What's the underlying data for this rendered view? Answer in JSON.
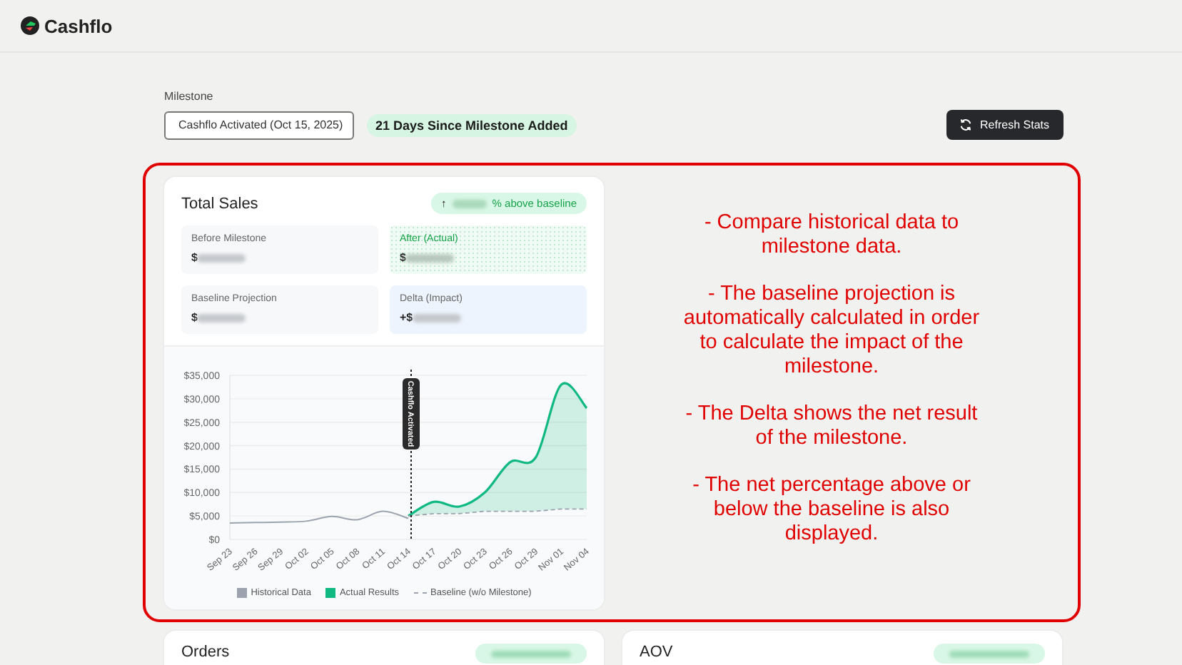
{
  "brand": {
    "name": "Cashflo"
  },
  "milestone": {
    "label": "Milestone",
    "selected_option": "Cashflo Activated (Oct 15, 2025)",
    "days_badge": "21 Days Since Milestone Added"
  },
  "refresh_button": {
    "label": "Refresh Stats"
  },
  "total_sales": {
    "title": "Total Sales",
    "badge": {
      "arrow": "↑",
      "text": "% above baseline"
    },
    "stats": [
      {
        "kind": "neutral",
        "label": "Before Milestone",
        "prefix": "$"
      },
      {
        "kind": "positive",
        "label": "After (Actual)",
        "prefix": "$"
      },
      {
        "kind": "neutral",
        "label": "Baseline Projection",
        "prefix": "$"
      },
      {
        "kind": "impact",
        "label": "Delta (Impact)",
        "prefix": "+$"
      }
    ],
    "chart_data": {
      "type": "line",
      "categories": [
        "Sep 23",
        "Sep 26",
        "Sep 29",
        "Oct 02",
        "Oct 05",
        "Oct 08",
        "Oct 11",
        "Oct 14",
        "Oct 17",
        "Oct 20",
        "Oct 23",
        "Oct 26",
        "Oct 29",
        "Nov 01",
        "Nov 04"
      ],
      "series": [
        {
          "name": "Historical Data",
          "color": "#9ca3af",
          "line_style": "solid",
          "values": [
            3500,
            3600,
            3700,
            3900,
            4900,
            4200,
            6000,
            4500,
            null,
            null,
            null,
            null,
            null,
            null,
            null
          ]
        },
        {
          "name": "Actual Results",
          "color": "#10b981",
          "line_style": "solid",
          "values": [
            null,
            null,
            null,
            null,
            null,
            null,
            null,
            5000,
            8000,
            7000,
            10000,
            16500,
            17500,
            33000,
            28000
          ]
        },
        {
          "name": "Baseline (w/o Milestone)",
          "color": "#9ca3af",
          "line_style": "dashed",
          "values": [
            null,
            null,
            null,
            null,
            null,
            null,
            null,
            5000,
            5500,
            5500,
            6000,
            6000,
            6000,
            6500,
            6500
          ]
        }
      ],
      "grid": true,
      "legend": true,
      "ylim": [
        0,
        35000
      ],
      "yticks": [
        {
          "value": 0,
          "label": "$0"
        },
        {
          "value": 5000,
          "label": "$5,000"
        },
        {
          "value": 10000,
          "label": "$10,000"
        },
        {
          "value": 15000,
          "label": "$15,000"
        },
        {
          "value": 20000,
          "label": "$20,000"
        },
        {
          "value": 25000,
          "label": "$25,000"
        },
        {
          "value": 30000,
          "label": "$30,000"
        },
        {
          "value": 35000,
          "label": "$35,000"
        }
      ],
      "ref_lines": [
        {
          "axis": "x",
          "value": "Oct 14",
          "label": "Cashflo Activated",
          "color": "#222222",
          "line_style": "dotted"
        }
      ]
    }
  },
  "notes": [
    "- Compare historical data to milestone data.",
    "- The baseline projection is automatically calculated in order to calculate the impact of the milestone.",
    "- The Delta shows the net result of the milestone.",
    "- The net percentage above or below the baseline is also displayed."
  ],
  "bottom_cards": [
    {
      "title": "Orders"
    },
    {
      "title": "AOV"
    }
  ]
}
